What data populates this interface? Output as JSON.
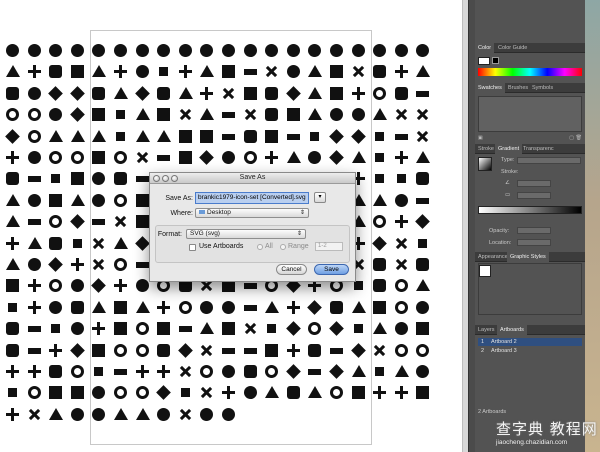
{
  "dialog": {
    "title": "Save As",
    "save_as_label": "Save As:",
    "filename": "brankic1979-icon-set [Converted].svg",
    "expand_glyph": "▾",
    "where_label": "Where:",
    "where_value": "Desktop",
    "format_label": "Format:",
    "format_value": "SVG (svg)",
    "use_artboards_label": "Use Artboards",
    "use_artboards_checked": false,
    "all_label": "All",
    "range_label": "Range",
    "range_value": "1-2",
    "cancel_label": "Cancel",
    "save_label": "Save"
  },
  "color_panel": {
    "tabs": [
      "Color",
      "Color Guide"
    ]
  },
  "swatches_panel": {
    "tabs": [
      "Swatches",
      "Brushes",
      "Symbols"
    ]
  },
  "stroke_panel": {
    "tabs": [
      "Stroke",
      "Gradient",
      "Transparenc"
    ],
    "type_label": "Type:",
    "stroke_label": "Stroke:",
    "angle_label": "∠",
    "ratio_label": "▭",
    "opacity_label": "Opacity:",
    "location_label": "Location:"
  },
  "appearance_panel": {
    "tabs": [
      "Appearance",
      "Graphic Styles"
    ]
  },
  "artboards_panel": {
    "tabs": [
      "Layers",
      "Artboards"
    ],
    "items": [
      {
        "number": "1",
        "name": "Artboard 2"
      },
      {
        "number": "2",
        "name": "Artboard 3"
      }
    ],
    "footer": "2 Artboards"
  },
  "watermark": {
    "title": "查字典 教程网",
    "url": "jiaocheng.chazidian.com"
  },
  "colors": {
    "panel_bg": "#535353",
    "selection": "#2f4f80",
    "save_button": "#6f9fe3"
  }
}
